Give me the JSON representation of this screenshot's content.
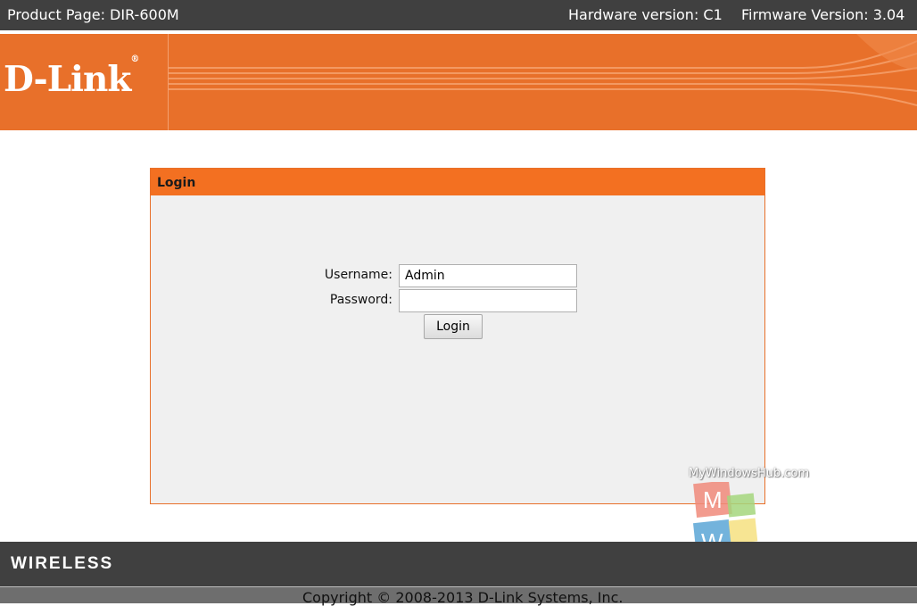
{
  "topbar": {
    "product": "Product Page: DIR-600M",
    "hardware": "Hardware version: C1",
    "firmware": "Firmware Version: 3.04"
  },
  "banner": {
    "logo": "D-Link",
    "trademark": "®"
  },
  "login": {
    "title": "Login",
    "username_label": "Username:",
    "username_value": "Admin",
    "password_label": "Password:",
    "password_value": "",
    "button": "Login"
  },
  "watermark": {
    "text": "MyWindowsHub.com",
    "m": "M",
    "w": "W"
  },
  "footer": {
    "wireless": "WIRELESS",
    "copyright": "Copyright © 2008-2013 D-Link Systems, Inc."
  },
  "colors": {
    "accent": "#f37021",
    "bar": "#404040",
    "panel": "#f0f0f0"
  }
}
